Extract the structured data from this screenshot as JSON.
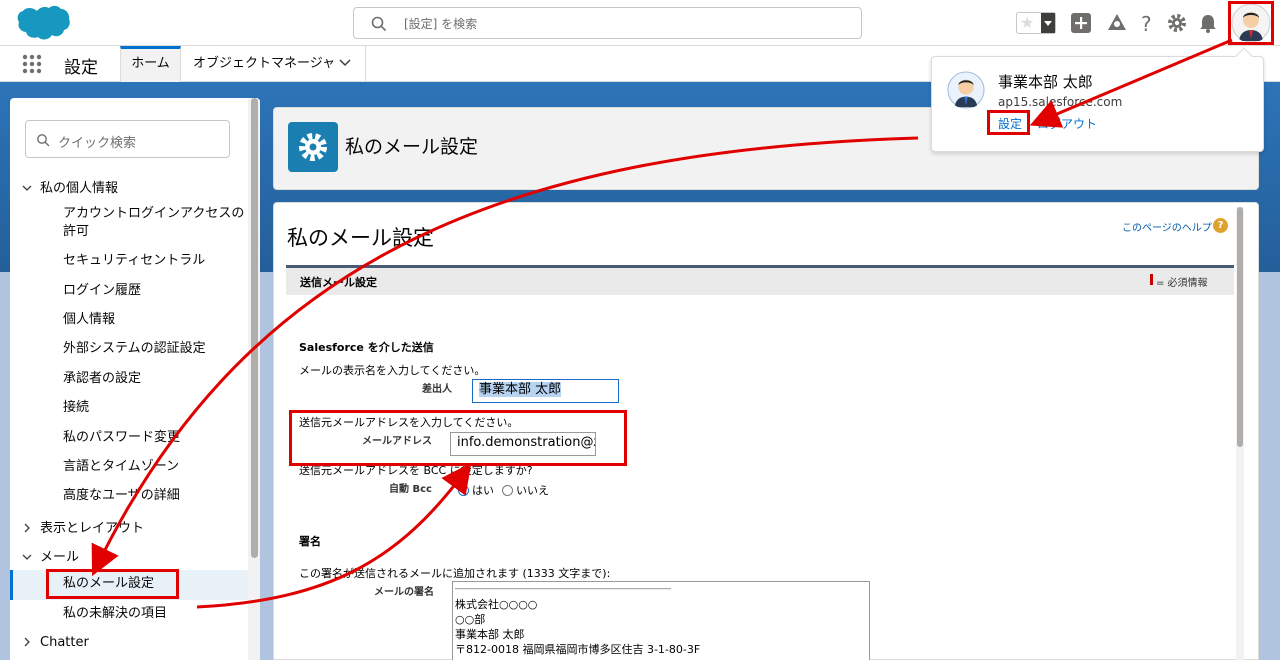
{
  "header": {
    "search_placeholder": "[設定] を検索",
    "app_name": "設定"
  },
  "nav": {
    "tab_home": "ホーム",
    "tab_object_manager": "オブジェクトマネージャ"
  },
  "sidebar": {
    "quick_search_placeholder": "クイック検索",
    "section_personal": "私の個人情報",
    "items": [
      "アカウントログインアクセスの許可",
      "セキュリティセントラル",
      "ログイン履歴",
      "個人情報",
      "外部システムの認証設定",
      "承認者の設定",
      "接続",
      "私のパスワード変更",
      "言語とタイムゾーン",
      "高度なユーザの詳細"
    ],
    "section_display": "表示とレイアウト",
    "section_email": "メール",
    "email_items": [
      "私のメール設定",
      "私の未解決の項目"
    ],
    "section_chatter": "Chatter"
  },
  "page_header": {
    "title": "私のメール設定"
  },
  "content": {
    "title": "私のメール設定",
    "help_link": "このページのヘルプ",
    "section_title": "送信メール設定",
    "required_info": "= 必須情報",
    "via_salesforce": "Salesforce を介した送信",
    "display_name_prompt": "メールの表示名を入力してください。",
    "sender_label": "差出人",
    "sender_value": "事業本部 太郎",
    "email_prompt": "送信元メールアドレスを入力してください。",
    "email_label": "メールアドレス",
    "email_value": "info.demonstration@z-",
    "bcc_prompt": "送信元メールアドレスを BCC に設定しますか?",
    "bcc_label": "自動 Bcc",
    "bcc_yes": "はい",
    "bcc_no": "いいえ",
    "signature_title": "署名",
    "signature_prompt": "この署名が送信されるメールに追加されます (1333 文字まで):",
    "signature_label": "メールの署名",
    "signature_lines": [
      "――――――――――――――――――――――――",
      "株式会社○○○○",
      "○○部",
      "事業本部 太郎",
      "〒812-0018 福岡県福岡市博多区住吉 3-1-80-3F"
    ]
  },
  "popover": {
    "user_name": "事業本部 太郎",
    "domain": "ap15.salesforce.com",
    "settings_link": "設定",
    "logout_link": "ログアウト"
  },
  "colors": {
    "accent": "#0070d2",
    "annotation_red": "#e00000",
    "setup_icon": "#1a7fb0"
  }
}
